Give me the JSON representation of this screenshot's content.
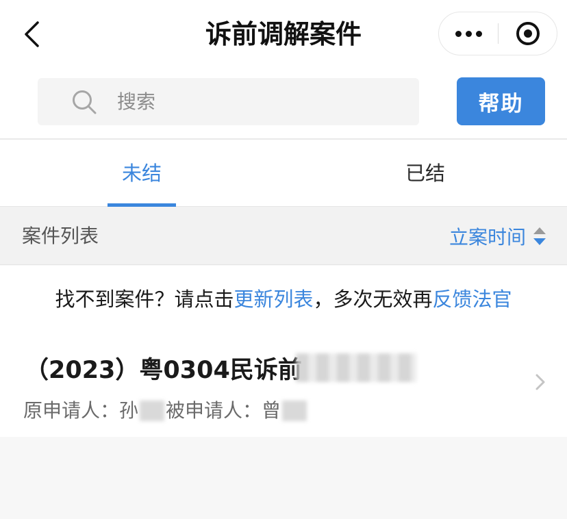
{
  "header": {
    "title": "诉前调解案件"
  },
  "search": {
    "placeholder": "搜索",
    "value": ""
  },
  "help_button": {
    "label": "帮助"
  },
  "tabs": [
    {
      "label": "未结",
      "active": true
    },
    {
      "label": "已结",
      "active": false
    }
  ],
  "list_header": {
    "title": "案件列表",
    "sort_label": "立案时间"
  },
  "notice": {
    "prefix": "找不到案件？请点击",
    "link1": "更新列表",
    "middle": "，多次无效再",
    "link2": "反馈法官"
  },
  "cases": [
    {
      "number_visible": "（2023）粤0304民诉前",
      "applicant_label": "原申请人：",
      "applicant_visible": "孙",
      "respondent_label": "被申请人：",
      "respondent_visible": "曾"
    }
  ],
  "colors": {
    "accent": "#3b86dd",
    "background": "#f7f7f7"
  }
}
